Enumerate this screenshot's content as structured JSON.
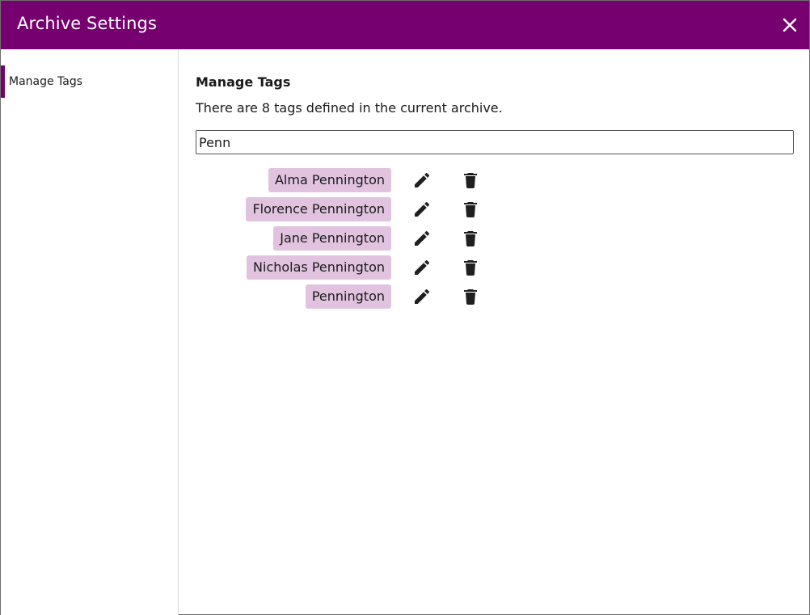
{
  "dialog": {
    "title": "Archive Settings",
    "close_icon": "close-icon"
  },
  "sidebar": {
    "items": [
      {
        "label": "Manage Tags",
        "active": true
      }
    ]
  },
  "main": {
    "heading": "Manage Tags",
    "description": "There are 8 tags defined in the current archive.",
    "filter": {
      "value": "Penn",
      "placeholder": ""
    },
    "tags": [
      {
        "label": "Alma Pennington"
      },
      {
        "label": "Florence Pennington"
      },
      {
        "label": "Jane Pennington"
      },
      {
        "label": "Nicholas Pennington"
      },
      {
        "label": "Pennington"
      }
    ],
    "row_icons": [
      "pencil-icon",
      "trash-icon"
    ]
  },
  "colors": {
    "accent": "#770070",
    "tag_background": "#e1c3e0"
  }
}
